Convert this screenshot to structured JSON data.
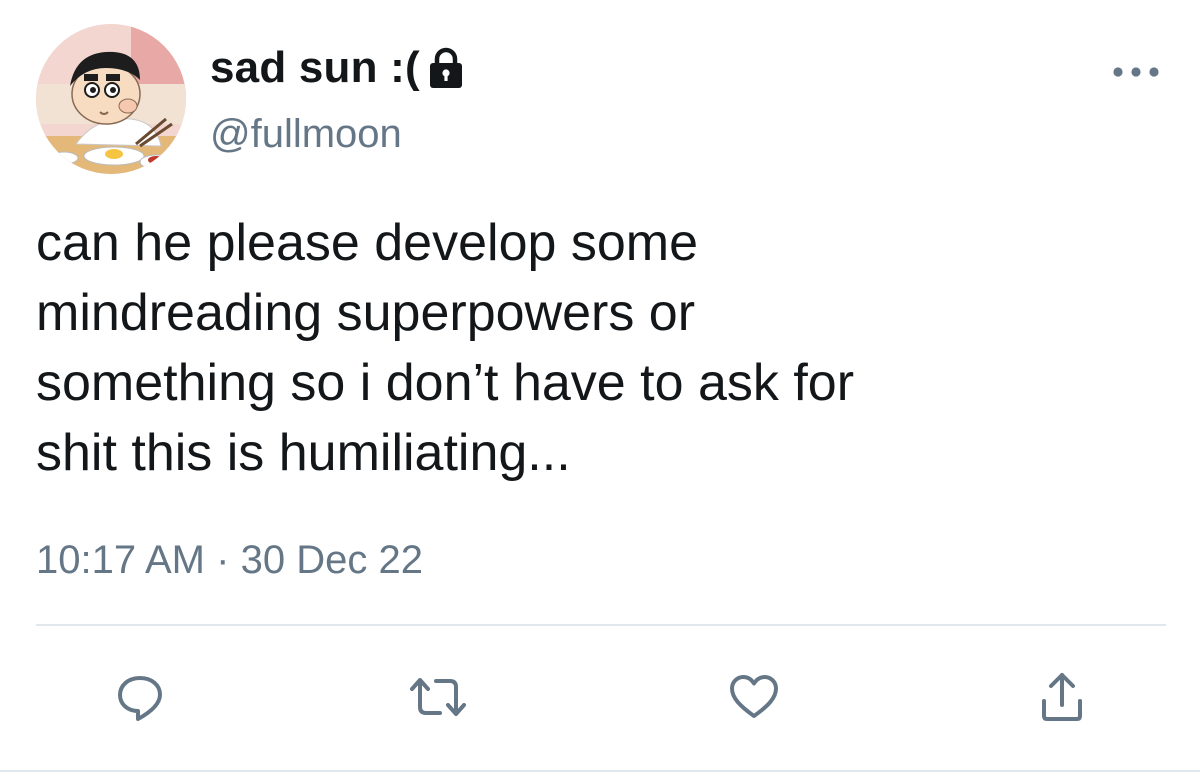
{
  "author": {
    "display_name": "sad sun :(",
    "handle": "@fullmoon",
    "locked": true,
    "avatar_icon": "cartoon-boy-eating-avatar"
  },
  "tweet": {
    "text": "can he please develop some\nmindreading superpowers or\nsomething so i don’t have to ask for\nshit this is humiliating...",
    "time": "10:17 AM",
    "separator": "·",
    "date": "30 Dec 22"
  },
  "icons": {
    "more": "more-horizontal-icon",
    "reply": "reply-icon",
    "retweet": "retweet-icon",
    "like": "heart-icon",
    "share": "share-icon"
  },
  "colors": {
    "text": "#14171a",
    "secondary": "#657786",
    "divider": "#e1e8ed"
  }
}
